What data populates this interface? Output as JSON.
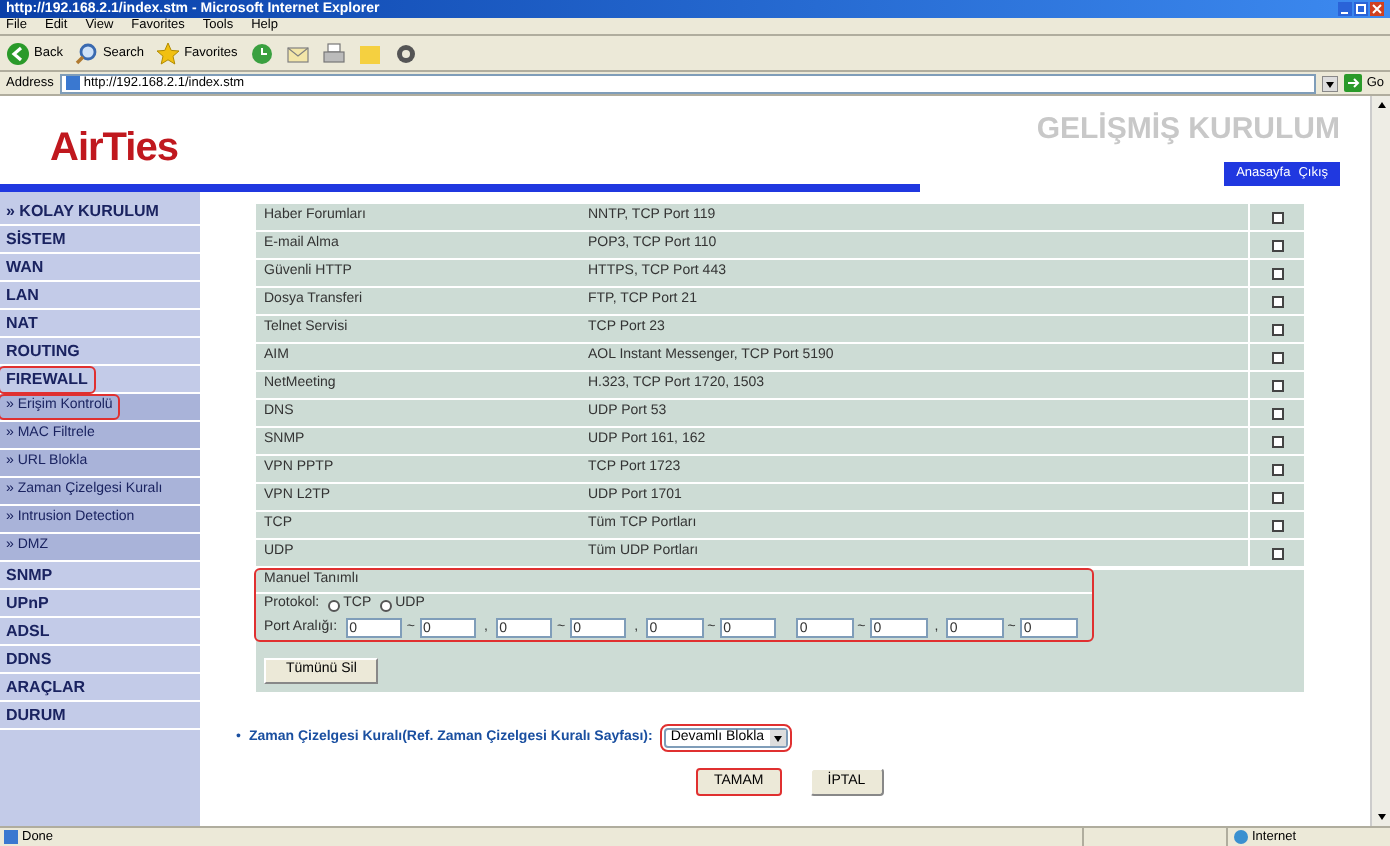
{
  "window": {
    "title": "http://192.168.2.1/index.stm - Microsoft Internet Explorer"
  },
  "menu": [
    "File",
    "Edit",
    "View",
    "Favorites",
    "Tools",
    "Help"
  ],
  "toolbar": [
    {
      "label": "Back",
      "kind": "back"
    },
    {
      "label": "Search",
      "kind": "search"
    },
    {
      "label": "Favorites",
      "kind": "favorites"
    }
  ],
  "address": {
    "label": "Address",
    "value": "http://192.168.2.1/index.stm",
    "go": "Go"
  },
  "header": {
    "logo": "AirTies",
    "title": "GELİŞMİŞ KURULUM",
    "links": [
      "Anasayfa",
      "Çıkış"
    ]
  },
  "sidebar": {
    "items": [
      {
        "label": "» KOLAY KURULUM",
        "highlighted": false
      },
      {
        "label": "SİSTEM",
        "highlighted": false
      },
      {
        "label": "WAN",
        "highlighted": false
      },
      {
        "label": "LAN",
        "highlighted": false
      },
      {
        "label": "NAT",
        "highlighted": false
      },
      {
        "label": "ROUTING",
        "highlighted": false
      },
      {
        "label": "FIREWALL",
        "highlighted": true,
        "children": [
          {
            "label": "» Erişim Kontrolü",
            "highlighted": true
          },
          {
            "label": "» MAC Filtrele",
            "highlighted": false
          },
          {
            "label": "» URL Blokla",
            "highlighted": false
          },
          {
            "label": "» Zaman Çizelgesi Kuralı",
            "highlighted": false
          },
          {
            "label": "» Intrusion Detection",
            "highlighted": false
          },
          {
            "label": "» DMZ",
            "highlighted": false
          }
        ]
      },
      {
        "label": "SNMP",
        "highlighted": false
      },
      {
        "label": "UPnP",
        "highlighted": false
      },
      {
        "label": "ADSL",
        "highlighted": false
      },
      {
        "label": "DDNS",
        "highlighted": false
      },
      {
        "label": "ARAÇLAR",
        "highlighted": false
      },
      {
        "label": "DURUM",
        "highlighted": false
      }
    ]
  },
  "services": [
    {
      "name": "Haber Forumları",
      "protocol": "NNTP, TCP Port 119",
      "checked": false
    },
    {
      "name": "E-mail Alma",
      "protocol": "POP3, TCP Port 110",
      "checked": false
    },
    {
      "name": "Güvenli HTTP",
      "protocol": "HTTPS, TCP Port 443",
      "checked": false
    },
    {
      "name": "Dosya Transferi",
      "protocol": "FTP, TCP Port 21",
      "checked": false
    },
    {
      "name": "Telnet Servisi",
      "protocol": "TCP Port 23",
      "checked": false
    },
    {
      "name": "AIM",
      "protocol": "AOL Instant Messenger, TCP Port 5190",
      "checked": false
    },
    {
      "name": "NetMeeting",
      "protocol": "H.323, TCP Port 1720, 1503",
      "checked": false
    },
    {
      "name": "DNS",
      "protocol": "UDP Port 53",
      "checked": false
    },
    {
      "name": "SNMP",
      "protocol": "UDP Port 161, 162",
      "checked": false
    },
    {
      "name": "VPN PPTP",
      "protocol": "TCP Port 1723",
      "checked": false
    },
    {
      "name": "VPN L2TP",
      "protocol": "UDP Port 1701",
      "checked": false
    },
    {
      "name": "TCP",
      "protocol": "Tüm TCP Portları",
      "checked": false
    },
    {
      "name": "UDP",
      "protocol": "Tüm UDP Portları",
      "checked": false
    }
  ],
  "manual": {
    "title": "Manuel Tanımlı",
    "highlighted": true,
    "protocol_label": "Protokol:",
    "options": [
      {
        "label": "TCP",
        "selected": false
      },
      {
        "label": "UDP",
        "selected": false
      }
    ],
    "port_label": "Port Aralığı:",
    "ranges": [
      {
        "from": "0",
        "sep": "~",
        "to": "0",
        "comma": ","
      },
      {
        "from": "0",
        "sep": "~",
        "to": "0",
        "comma": ","
      },
      {
        "from": "0",
        "sep": "~",
        "to": "0"
      },
      {
        "from": "0",
        "sep": "~",
        "to": "0",
        "comma": ","
      },
      {
        "from": "0",
        "sep": "~",
        "to": "0"
      }
    ],
    "clear_button": "Tümünü Sil"
  },
  "schedule": {
    "bullet": "•",
    "label": "Zaman Çizelgesi Kuralı(Ref. Zaman Çizelgesi Kuralı Sayfası):",
    "value": "Devamlı Blokla",
    "highlighted": true
  },
  "buttons": [
    {
      "label": "TAMAM",
      "highlighted": true
    },
    {
      "label": "İPTAL",
      "highlighted": false
    }
  ],
  "status_bar": {
    "text": "Done",
    "zone": "Internet"
  }
}
